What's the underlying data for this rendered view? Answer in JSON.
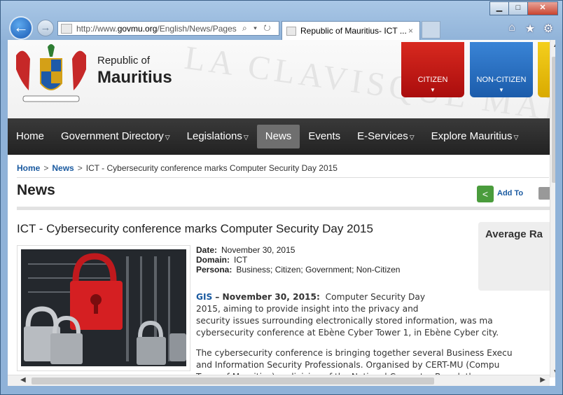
{
  "browser": {
    "url_prefix": "http://www.",
    "url_domain": "govmu.org",
    "url_rest": "/English/News/Pages",
    "tab_title": "Republic of Mauritius- ICT ...",
    "tab_close": "×",
    "back_icon": "←",
    "forward_icon": "→",
    "addr_controls": "⌕ ▾ ↻",
    "home_icon": "⌂",
    "favorites_icon": "★",
    "tools_icon": "⚙",
    "minimize": "▁",
    "maximize": "□",
    "close": "✕"
  },
  "header": {
    "republic_of": "Republic of",
    "mauritius": "Mauritius",
    "watermark": "LA CLAVISQUE MARIS",
    "citizen": "CITIZEN",
    "non_citizen": "NON-CITIZEN",
    "chevron": "▼"
  },
  "menu": {
    "items": [
      {
        "label": "Home",
        "caret": ""
      },
      {
        "label": "Government Directory",
        "caret": "▽"
      },
      {
        "label": "Legislations",
        "caret": "▽"
      },
      {
        "label": "News",
        "caret": ""
      },
      {
        "label": "Events",
        "caret": ""
      },
      {
        "label": "E-Services",
        "caret": "▽"
      },
      {
        "label": "Explore Mauritius",
        "caret": "▽"
      }
    ]
  },
  "breadcrumb": {
    "home": "Home",
    "news": "News",
    "sep": ">",
    "current": "ICT - Cybersecurity conference marks Computer Security Day 2015"
  },
  "page": {
    "title": "News",
    "add_to": "Add To",
    "share_icon": "<"
  },
  "article": {
    "title": "ICT - Cybersecurity conference marks Computer Security Day 2015",
    "date_label": "Date:",
    "date": "November 30, 2015",
    "domain_label": "Domain:",
    "domain": "ICT",
    "persona_label": "Persona:",
    "persona": "Business; Citizen; Government; Non-Citizen",
    "gis": "GIS",
    "dateline": "– November 30, 2015:",
    "p1_l1": "Computer Security Day",
    "p1_l2": "2015, aiming to provide insight into the privacy and",
    "p1_l3": "security issues surrounding electronically stored information, was ma",
    "p1_l4": "cybersecurity conference at Ebène Cyber Tower 1, in Ebène Cyber city.",
    "p2_l1": "The cybersecurity conference is bringing together several Business Execu",
    "p2_l2": "and Information Security Professionals.  Organised by CERT-MU (Compu",
    "p2_l3": "Team of Mauritius), a division of the National Computer Board, the c"
  },
  "sidebar": {
    "title": "Average Ra"
  },
  "scroll": {
    "up": "▲",
    "down": "▼",
    "left": "◀",
    "right": "▶"
  }
}
